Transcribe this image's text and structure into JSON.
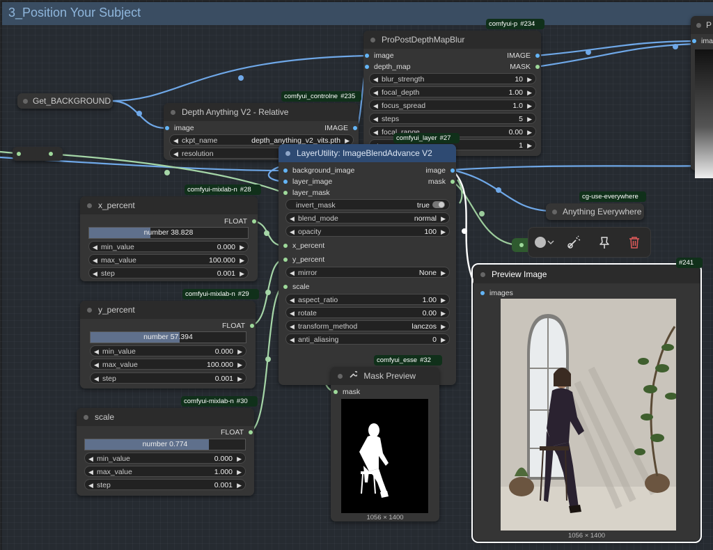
{
  "group": {
    "title": "3_Position Your Subject"
  },
  "nodes": {
    "get_background": {
      "title": "Get_BACKGROUND"
    },
    "depth_anything": {
      "title": "Depth Anything V2 - Relative",
      "badge": "comfyui_controlne",
      "badge_num": "#235",
      "in_image": "image",
      "out_image": "IMAGE",
      "ckpt_label": "ckpt_name",
      "ckpt_value": "depth_anything_v2_vits.pth",
      "resolution_label": "resolution"
    },
    "propost": {
      "title": "ProPostDepthMapBlur",
      "badge": "comfyui-p",
      "badge_num": "#234",
      "in_image": "image",
      "in_depth": "depth_map",
      "out_image": "IMAGE",
      "out_mask": "MASK",
      "widgets": [
        {
          "label": "blur_strength",
          "value": "10"
        },
        {
          "label": "focal_depth",
          "value": "1.00"
        },
        {
          "label": "focus_spread",
          "value": "1.0"
        },
        {
          "label": "steps",
          "value": "5"
        },
        {
          "label": "focal_range",
          "value": "0.00"
        },
        {
          "label": "",
          "value": "1"
        }
      ]
    },
    "preview_top": {
      "title": "P",
      "in_images": "ima"
    },
    "blend": {
      "title": "LayerUtility: ImageBlendAdvance V2",
      "badge": "comfyui_layer",
      "badge_num": "#27",
      "in_bg": "background_image",
      "in_layer": "layer_image",
      "in_mask": "layer_mask",
      "out_image": "image",
      "out_mask": "mask",
      "invert_label": "invert_mask",
      "invert_value": "true",
      "blend_label": "blend_mode",
      "blend_value": "normal",
      "opacity_label": "opacity",
      "opacity_value": "100",
      "in_x": "x_percent",
      "in_y": "y_percent",
      "mirror_label": "mirror",
      "mirror_value": "None",
      "in_scale": "scale",
      "aspect_label": "aspect_ratio",
      "aspect_value": "1.00",
      "rotate_label": "rotate",
      "rotate_value": "0.00",
      "transform_label": "transform_method",
      "transform_value": "lanczos",
      "aa_label": "anti_aliasing",
      "aa_value": "0"
    },
    "x_percent": {
      "title": "x_percent",
      "badge": "comfyui-mixlab-n",
      "badge_num": "#28",
      "out": "FLOAT",
      "number_text": "number  38.828",
      "fill": 0.388,
      "min_label": "min_value",
      "min_value": "0.000",
      "max_label": "max_value",
      "max_value": "100.000",
      "step_label": "step",
      "step_value": "0.001"
    },
    "y_percent": {
      "title": "y_percent",
      "badge": "comfyui-mixlab-n",
      "badge_num": "#29",
      "out": "FLOAT",
      "number_text": "number  57.394",
      "fill": 0.574,
      "min_label": "min_value",
      "min_value": "0.000",
      "max_label": "max_value",
      "max_value": "100.000",
      "step_label": "step",
      "step_value": "0.001"
    },
    "scale": {
      "title": "scale",
      "badge": "comfyui-mixlab-n",
      "badge_num": "#30",
      "out": "FLOAT",
      "number_text": "number  0.774",
      "fill": 0.774,
      "min_label": "min_value",
      "min_value": "0.000",
      "max_label": "max_value",
      "max_value": "1.000",
      "step_label": "step",
      "step_value": "0.001"
    },
    "anything": {
      "title": "Anything Everywhere",
      "badge": "cg-use-everywhere"
    },
    "mask_preview": {
      "title": "Mask Preview",
      "badge": "comfyui_esse",
      "badge_num": "#32",
      "in_mask": "mask",
      "size": "1056 × 1400"
    },
    "preview": {
      "title": "Preview Image",
      "badge_num": "#241",
      "in_images": "images",
      "size": "1056 × 1400"
    }
  },
  "toolbar": {
    "icons": [
      "color-circle-icon",
      "chevron-down-icon",
      "bypass-wand-icon",
      "pin-icon",
      "trash-icon"
    ]
  },
  "colors": {
    "wire_image": "#6fa8e8",
    "wire_float": "#a5d6a7",
    "wire_mask": "#9ccc9c",
    "selection": "#ffffff",
    "group_title": "#8fb6dc"
  }
}
